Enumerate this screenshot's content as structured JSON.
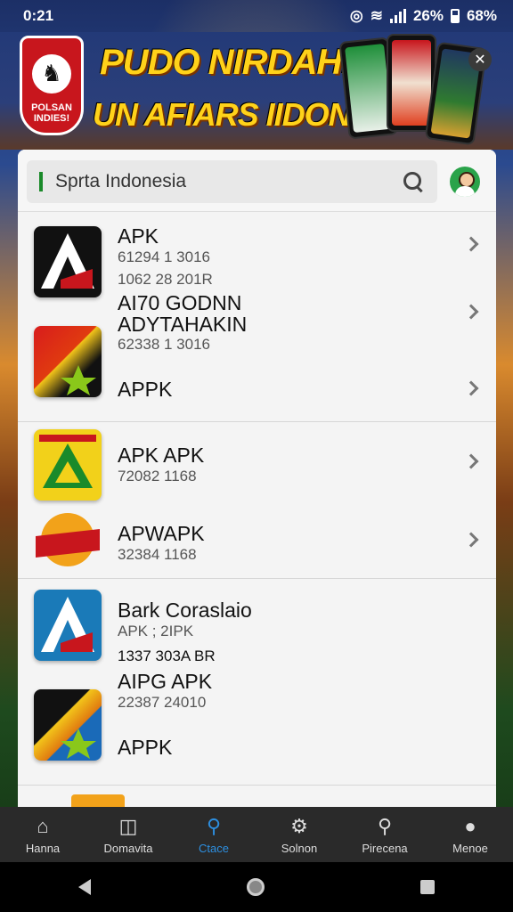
{
  "status": {
    "time": "0:21",
    "battery_a": "26%",
    "battery_b": "68%"
  },
  "banner": {
    "title": "PUDO NIRDAHN",
    "subtitle": "UN AFIARS IIDONAI!",
    "logo_text": "POLSAN INDIES!"
  },
  "search": {
    "value": "Sprta Indonesia"
  },
  "list": [
    {
      "name": "APK",
      "meta1": "61294 1 3016",
      "meta2": "1062 28 201R"
    },
    {
      "name": "AI70 GODNN",
      "name2": "ADYTAHAKIN",
      "meta1": "62338 1 3016"
    },
    {
      "name": "APPK"
    },
    {
      "name": "APK APK",
      "meta1": "72082 1168"
    },
    {
      "name": "APWAPK",
      "meta1": "32384 1168"
    },
    {
      "name": "Bark Coraslaio",
      "meta1": "APK ; 2IPK",
      "meta2": "1337 303A BR"
    },
    {
      "name": "AIPG APK",
      "meta1": "22387 24010"
    },
    {
      "name": "APPK"
    }
  ],
  "nav": {
    "items": [
      {
        "label": "Hanna",
        "icon": "home-icon"
      },
      {
        "label": "Domavita",
        "icon": "map-icon"
      },
      {
        "label": "Ctace",
        "icon": "search-icon"
      },
      {
        "label": "Solnon",
        "icon": "settings-icon"
      },
      {
        "label": "Pirecena",
        "icon": "search-alt-icon"
      },
      {
        "label": "Menoe",
        "icon": "user-icon"
      }
    ],
    "active_color": "#2d8fe0"
  }
}
